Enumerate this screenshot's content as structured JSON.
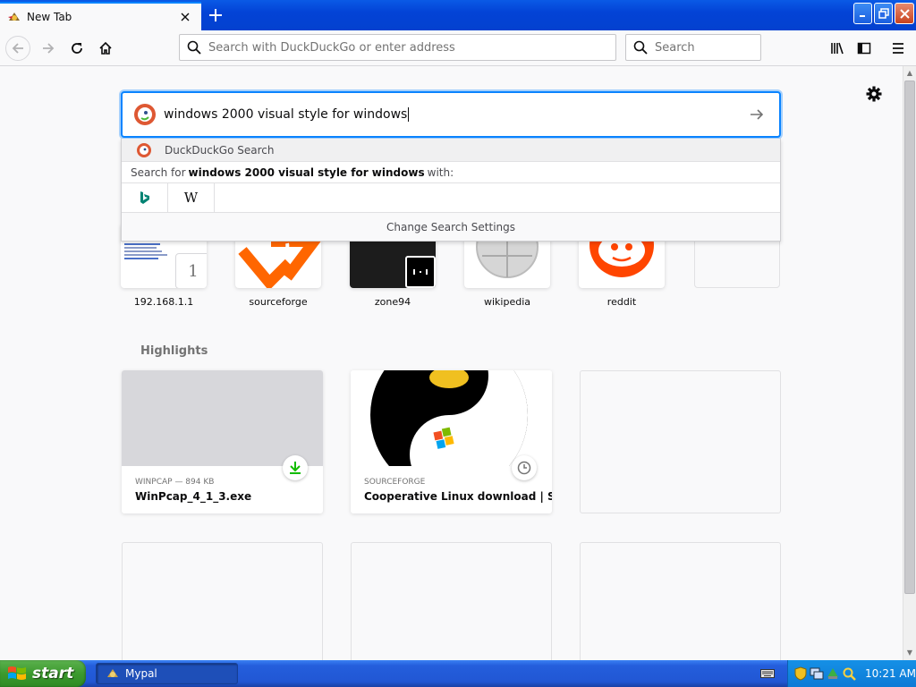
{
  "tab": {
    "title": "New Tab"
  },
  "navbar": {
    "url_placeholder": "Search with DuckDuckGo or enter address",
    "search_placeholder": "Search"
  },
  "search": {
    "query": "windows 2000 visual style for windows",
    "dropdown": {
      "engine_row": "DuckDuckGo Search",
      "search_for_prefix": "Search for",
      "search_for_query": "windows 2000 visual style for windows",
      "search_for_suffix": "with:",
      "engines": [
        "bing-icon",
        "wikipedia-icon"
      ],
      "wikipedia_glyph": "W",
      "settings": "Change Search Settings"
    }
  },
  "top_sites": [
    {
      "label": "192.168.1.1",
      "badge": "1"
    },
    {
      "label": "sourceforge"
    },
    {
      "label": "zone94"
    },
    {
      "label": "wikipedia"
    },
    {
      "label": "reddit"
    },
    {
      "label": ""
    }
  ],
  "highlights": {
    "title": "Highlights",
    "cards": [
      {
        "source": "WINPCAP — 894 KB",
        "title": "WinPcap_4_1_3.exe",
        "badge_icon": "download-icon"
      },
      {
        "source": "SOURCEFORGE",
        "title": "Cooperative Linux download | S...",
        "badge_icon": "clock-icon"
      }
    ]
  },
  "taskbar": {
    "start": "start",
    "window": "Mypal",
    "clock": "10:21 AM"
  },
  "colors": {
    "accent": "#0a84ff",
    "xp_blue": "#245edc",
    "start_green": "#3c9a2e"
  }
}
